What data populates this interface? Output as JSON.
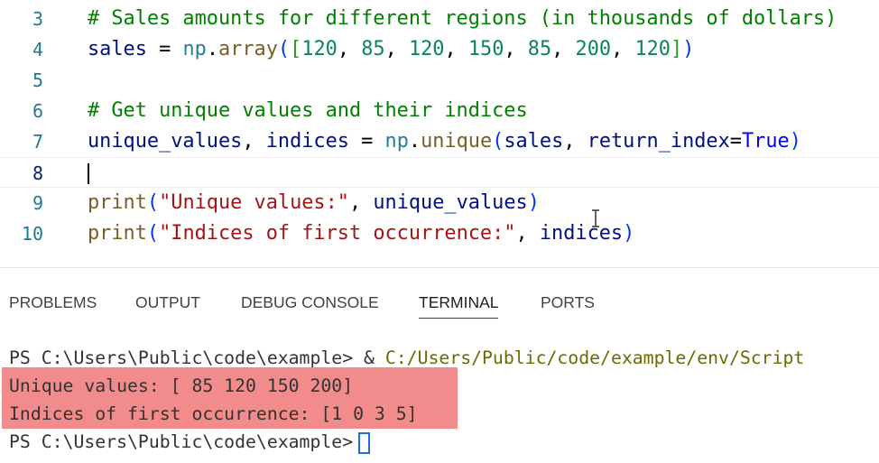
{
  "editor": {
    "lines": [
      {
        "number": "3",
        "text": "# Sales amounts for different regions (in thousands of dollars)"
      },
      {
        "number": "4",
        "text": "sales = np.array([120, 85, 120, 150, 85, 200, 120])"
      },
      {
        "number": "5",
        "text": ""
      },
      {
        "number": "6",
        "text": "# Get unique values and their indices"
      },
      {
        "number": "7",
        "text": "unique_values, indices = np.unique(sales, return_index=True)"
      },
      {
        "number": "8",
        "text": ""
      },
      {
        "number": "9",
        "text": "print(\"Unique values:\", unique_values)"
      },
      {
        "number": "10",
        "text": "print(\"Indices of first occurrence:\", indices)"
      }
    ],
    "active_line": "8"
  },
  "panel": {
    "tabs": [
      {
        "label": "PROBLEMS"
      },
      {
        "label": "OUTPUT"
      },
      {
        "label": "DEBUG CONSOLE"
      },
      {
        "label": "TERMINAL",
        "active": true
      },
      {
        "label": "PORTS"
      }
    ]
  },
  "terminal": {
    "prompt": "PS C:\\Users\\Public\\code\\example>",
    "command_prefix": " & ",
    "command_path": "C:/Users/Public/code/example/env/Script",
    "output": [
      "Unique values: [ 85 120 150 200]",
      "Indices of first occurrence: [1 0 3 5]"
    ],
    "final_prompt": "PS C:\\Users\\Public\\code\\example>"
  },
  "colors": {
    "highlight": "#f28b8b",
    "comment": "#008000",
    "string": "#a31515",
    "number": "#098658",
    "function": "#795e26",
    "variable": "#001080",
    "cursor": "#1f6fd6"
  }
}
